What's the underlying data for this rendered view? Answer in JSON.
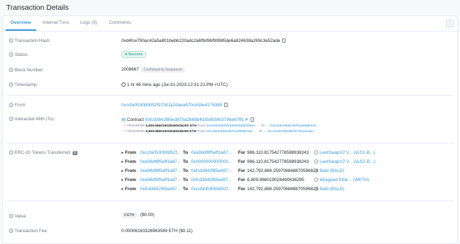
{
  "page": {
    "title": "Transaction Details"
  },
  "tabs": [
    {
      "label": "Overview"
    },
    {
      "label": "Internal Txns"
    },
    {
      "label": "Logs (9)"
    },
    {
      "label": "Comments"
    }
  ],
  "more_button": ":",
  "labels": {
    "hash": "Transaction Hash:",
    "status": "Status:",
    "block": "Block Number:",
    "timestamp": "Timestamp:",
    "from": "From:",
    "interacted": "Interacted With (To):",
    "erc20": "ERC-20 Tokens Transferred:",
    "value": "Value:",
    "fee": "Transaction Fee:"
  },
  "hash": "0xd4fce790ac42a5a801bebb220adc2a6f9d9bf99985de6a824638a269c3e52ade",
  "status": "Success",
  "block": {
    "number": "2008667",
    "badge": "Confirmed by Sequencer"
  },
  "timestamp": "1 hr 46 mins ago (Jul-31-2023 12:31:21 PM +UTC)",
  "from": "0xccfa0530b9d52f970d1a2daea670ce58e4176389",
  "interacted": {
    "prefix": "Contract",
    "address": "0xfcd3842f85ed87ba2889b4d35893403796e67ff1",
    "transfers": [
      {
        "tag": "TRANSFER",
        "amount": "6,809.96601902849063629S ETH",
        "from_label": "From",
        "from": "0x420000000000000000000000...",
        "to_label": "To",
        "to": "0xfcd3842f85ed87ba2889b4d3..."
      },
      {
        "tag": "TRANSFER",
        "amount": "6,809.966019028490636295 ETH",
        "from_label": "From",
        "from": "0xfcd3842f85ed87ba2889b4d3...",
        "to_label": "To",
        "to": "0xccfa0530b9d52f970d1a2dae..."
      }
    ]
  },
  "erc20": {
    "count": "5",
    "rows": [
      {
        "from_label": "From",
        "from": "0xccfa0530b9d52f...",
        "to_label": "To",
        "to": "0xe96df8f5eff1a87...",
        "for_label": "For",
        "amount": "986,110.817542778598938243",
        "token": "LeetSwapV2 V... (vLS2-B...)"
      },
      {
        "from_label": "From",
        "from": "0xe96df8f5eff1a87...",
        "to_label": "To",
        "to": "0x0000000000000...",
        "for_label": "For",
        "amount": "986,110.817542778598938243",
        "token": "LeetSwapV2 V... (vLS2-B...)"
      },
      {
        "from_label": "From",
        "from": "0xe96df8f5eff1a87...",
        "to_label": "To",
        "to": "0xfcd3842f85ed87...",
        "for_label": "For",
        "amount": "142,792,868.259706848870596824",
        "token": "Bald (BALD)"
      },
      {
        "from_label": "From",
        "from": "0xe96df8f5eff1a87...",
        "to_label": "To",
        "to": "0xfcd3842f85ed87...",
        "for_label": "For",
        "amount": "6,809.966019028490636295",
        "token": "Wrapped Ethe... (WETH)"
      },
      {
        "from_label": "From",
        "from": "0xfcd3842f85ed87...",
        "to_label": "To",
        "to": "0xccfa0530b9d52f...",
        "for_label": "For",
        "amount": "142,792,868.259706848870596824",
        "token": "Bald (BALD)"
      }
    ]
  },
  "value": {
    "amount": "0 ETH",
    "usd": "($0.00)"
  },
  "fee": "0.00006163326963599 ETH ($0.11)",
  "colors": {
    "accent": "#3498db",
    "success": "#00a186"
  },
  "icons": {
    "help": "question-circle-icon",
    "copy": "copy-icon",
    "clock": "clock-icon",
    "contract": "file-contract-icon",
    "verified": "check-circle-icon",
    "token": "token-icon"
  }
}
